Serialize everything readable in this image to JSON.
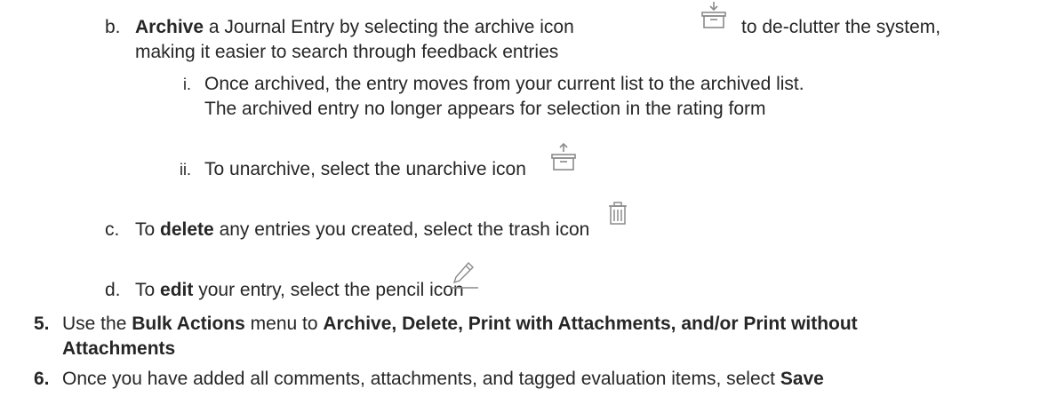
{
  "items": {
    "b": {
      "marker": "b.",
      "bold": "Archive",
      "text1": "a Journal Entry by selecting the archive icon",
      "text2": "to de-clutter the system,",
      "line2": "making it easier to search through feedback entries",
      "icon": "archive-icon"
    },
    "b_i": {
      "marker": "i.",
      "line1": "Once archived, the entry moves from your current list to the archived list.",
      "line2": "The archived entry no longer appears for selection in the rating form"
    },
    "b_ii": {
      "marker": "ii.",
      "text": "To unarchive, select the unarchive icon",
      "icon": "unarchive-icon"
    },
    "c": {
      "marker": "c.",
      "pre": "To",
      "bold": "delete",
      "post": "any entries you created, select the trash icon",
      "icon": "trash-icon"
    },
    "d": {
      "marker": "d.",
      "pre": "To",
      "bold": "edit",
      "post": "your entry, select the pencil icon",
      "icon": "pencil-icon"
    },
    "n5": {
      "marker": "5.",
      "pre": "Use the",
      "bold1": "Bulk Actions",
      "mid": "menu to",
      "bold2": "Archive, Delete, Print with Attachments, and/or Print without",
      "bold3": "Attachments"
    },
    "n6": {
      "marker": "6.",
      "text": "Once you have added all comments, attachments, and tagged evaluation items, select",
      "bold": "Save"
    }
  },
  "colors": {
    "text": "#262626",
    "icon": "#8a8a8a"
  }
}
